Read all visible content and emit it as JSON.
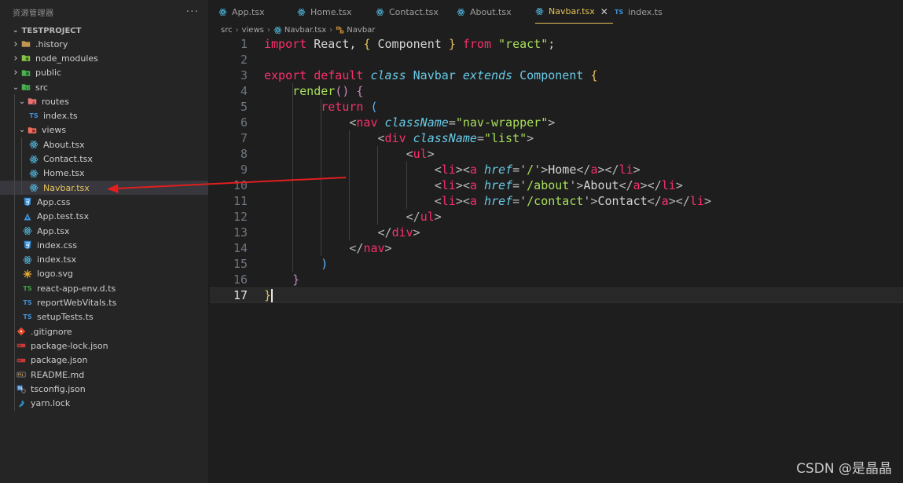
{
  "sidebar": {
    "title": "资源管理器",
    "more": "···",
    "project": "TESTPROJECT",
    "tree": [
      {
        "label": ".history",
        "chev": "›",
        "icon": "folder-icon"
      },
      {
        "label": "node_modules",
        "chev": "›",
        "icon": "folder-node-icon"
      },
      {
        "label": "public",
        "chev": "›",
        "icon": "folder-public-icon"
      },
      {
        "label": "src",
        "chev": "⌄",
        "icon": "folder-src-icon"
      },
      {
        "label": "routes",
        "chev": "⌄",
        "icon": "folder-routes-icon"
      },
      {
        "label": "index.ts",
        "chev": "",
        "icon": "typescript-icon"
      },
      {
        "label": "views",
        "chev": "⌄",
        "icon": "folder-views-icon"
      },
      {
        "label": "About.tsx",
        "chev": "",
        "icon": "react-icon"
      },
      {
        "label": "Contact.tsx",
        "chev": "",
        "icon": "react-icon"
      },
      {
        "label": "Home.tsx",
        "chev": "",
        "icon": "react-icon"
      },
      {
        "label": "Navbar.tsx",
        "chev": "",
        "icon": "react-icon"
      },
      {
        "label": "App.css",
        "chev": "",
        "icon": "css-icon"
      },
      {
        "label": "App.test.tsx",
        "chev": "",
        "icon": "test-icon"
      },
      {
        "label": "App.tsx",
        "chev": "",
        "icon": "react-icon"
      },
      {
        "label": "index.css",
        "chev": "",
        "icon": "css-icon"
      },
      {
        "label": "index.tsx",
        "chev": "",
        "icon": "react-icon"
      },
      {
        "label": "logo.svg",
        "chev": "",
        "icon": "svg-icon"
      },
      {
        "label": "react-app-env.d.ts",
        "chev": "",
        "icon": "typescript-def-icon"
      },
      {
        "label": "reportWebVitals.ts",
        "chev": "",
        "icon": "typescript-icon"
      },
      {
        "label": "setupTests.ts",
        "chev": "",
        "icon": "typescript-icon"
      },
      {
        "label": ".gitignore",
        "chev": "",
        "icon": "git-icon"
      },
      {
        "label": "package-lock.json",
        "chev": "",
        "icon": "npm-icon"
      },
      {
        "label": "package.json",
        "chev": "",
        "icon": "npm-icon"
      },
      {
        "label": "README.md",
        "chev": "",
        "icon": "markdown-icon"
      },
      {
        "label": "tsconfig.json",
        "chev": "",
        "icon": "tsconfig-icon"
      },
      {
        "label": "yarn.lock",
        "chev": "",
        "icon": "yarn-icon"
      }
    ],
    "selected": "Navbar.tsx"
  },
  "tabs": [
    {
      "label": "App.tsx",
      "icon": "react-icon"
    },
    {
      "label": "Home.tsx",
      "icon": "react-icon"
    },
    {
      "label": "Contact.tsx",
      "icon": "react-icon"
    },
    {
      "label": "About.tsx",
      "icon": "react-icon"
    },
    {
      "label": "Navbar.tsx",
      "icon": "react-icon",
      "active": true,
      "close": "✕"
    },
    {
      "label": "index.ts",
      "icon": "typescript-icon"
    }
  ],
  "breadcrumb": {
    "items": [
      "src",
      "views",
      "Navbar.tsx",
      "Navbar"
    ],
    "sep": "›"
  },
  "editor": {
    "line_numbers": [
      "1",
      "2",
      "3",
      "4",
      "5",
      "6",
      "7",
      "8",
      "9",
      "10",
      "11",
      "12",
      "13",
      "14",
      "15",
      "16",
      "17"
    ],
    "current_line": "17",
    "code": [
      [
        [
          "k",
          "import"
        ],
        [
          "w",
          " React, "
        ],
        [
          "s",
          "{"
        ],
        [
          "w",
          " Component "
        ],
        [
          "s",
          "}"
        ],
        [
          "w",
          " "
        ],
        [
          "k",
          "from"
        ],
        [
          "w",
          " "
        ],
        [
          "g",
          "\"react\""
        ],
        [
          "w",
          ";"
        ]
      ],
      [],
      [
        [
          "k",
          "export"
        ],
        [
          "w",
          " "
        ],
        [
          "k",
          "default"
        ],
        [
          "w",
          " "
        ],
        [
          "ci",
          "class"
        ],
        [
          "w",
          " "
        ],
        [
          "c",
          "Navbar"
        ],
        [
          "w",
          " "
        ],
        [
          "ci",
          "extends"
        ],
        [
          "w",
          " "
        ],
        [
          "c",
          "Component"
        ],
        [
          "w",
          " "
        ],
        [
          "s",
          "{"
        ]
      ],
      [
        [
          "w",
          "    "
        ],
        [
          "g",
          "render"
        ],
        [
          "pp",
          "()"
        ],
        [
          "w",
          " "
        ],
        [
          "pp",
          "{"
        ]
      ],
      [
        [
          "w",
          "        "
        ],
        [
          "k",
          "return"
        ],
        [
          "w",
          " "
        ],
        [
          "bl",
          "("
        ]
      ],
      [
        [
          "w",
          "            "
        ],
        [
          "pu",
          "<"
        ],
        [
          "tg",
          "nav"
        ],
        [
          "w",
          " "
        ],
        [
          "at",
          "className"
        ],
        [
          "pu",
          "="
        ],
        [
          "g",
          "\"nav-wrapper\""
        ],
        [
          "pu",
          ">"
        ]
      ],
      [
        [
          "w",
          "                "
        ],
        [
          "pu",
          "<"
        ],
        [
          "tg",
          "div"
        ],
        [
          "w",
          " "
        ],
        [
          "at",
          "className"
        ],
        [
          "pu",
          "="
        ],
        [
          "g",
          "\"list\""
        ],
        [
          "pu",
          ">"
        ]
      ],
      [
        [
          "w",
          "                    "
        ],
        [
          "pu",
          "<"
        ],
        [
          "tg",
          "ul"
        ],
        [
          "pu",
          ">"
        ]
      ],
      [
        [
          "w",
          "                        "
        ],
        [
          "pu",
          "<"
        ],
        [
          "tg",
          "li"
        ],
        [
          "pu",
          "><"
        ],
        [
          "tg",
          "a"
        ],
        [
          "w",
          " "
        ],
        [
          "at",
          "href"
        ],
        [
          "pu",
          "='"
        ],
        [
          "g",
          "/"
        ],
        [
          "pu",
          "'>"
        ],
        [
          "w",
          "Home"
        ],
        [
          "pu",
          "</"
        ],
        [
          "tg",
          "a"
        ],
        [
          "pu",
          "></"
        ],
        [
          "tg",
          "li"
        ],
        [
          "pu",
          ">"
        ]
      ],
      [
        [
          "w",
          "                        "
        ],
        [
          "pu",
          "<"
        ],
        [
          "tg",
          "li"
        ],
        [
          "pu",
          "><"
        ],
        [
          "tg",
          "a"
        ],
        [
          "w",
          " "
        ],
        [
          "at",
          "href"
        ],
        [
          "pu",
          "='"
        ],
        [
          "g",
          "/about"
        ],
        [
          "pu",
          "'>"
        ],
        [
          "w",
          "About"
        ],
        [
          "pu",
          "</"
        ],
        [
          "tg",
          "a"
        ],
        [
          "pu",
          "></"
        ],
        [
          "tg",
          "li"
        ],
        [
          "pu",
          ">"
        ]
      ],
      [
        [
          "w",
          "                        "
        ],
        [
          "pu",
          "<"
        ],
        [
          "tg",
          "li"
        ],
        [
          "pu",
          "><"
        ],
        [
          "tg",
          "a"
        ],
        [
          "w",
          " "
        ],
        [
          "at",
          "href"
        ],
        [
          "pu",
          "='"
        ],
        [
          "g",
          "/contact"
        ],
        [
          "pu",
          "'>"
        ],
        [
          "w",
          "Contact"
        ],
        [
          "pu",
          "</"
        ],
        [
          "tg",
          "a"
        ],
        [
          "pu",
          "></"
        ],
        [
          "tg",
          "li"
        ],
        [
          "pu",
          ">"
        ]
      ],
      [
        [
          "w",
          "                    "
        ],
        [
          "pu",
          "</"
        ],
        [
          "tg",
          "ul"
        ],
        [
          "pu",
          ">"
        ]
      ],
      [
        [
          "w",
          "                "
        ],
        [
          "pu",
          "</"
        ],
        [
          "tg",
          "div"
        ],
        [
          "pu",
          ">"
        ]
      ],
      [
        [
          "w",
          "            "
        ],
        [
          "pu",
          "</"
        ],
        [
          "tg",
          "nav"
        ],
        [
          "pu",
          ">"
        ]
      ],
      [
        [
          "w",
          "        "
        ],
        [
          "bl",
          ")"
        ]
      ],
      [
        [
          "w",
          "    "
        ],
        [
          "pp",
          "}"
        ]
      ],
      [
        [
          "s",
          "}"
        ]
      ]
    ]
  },
  "watermark": "CSDN @是晶晶",
  "colors": {
    "accent": "#e8c35a",
    "annotation_arrow": "#e01f1f",
    "selected_row": "#37373d"
  }
}
